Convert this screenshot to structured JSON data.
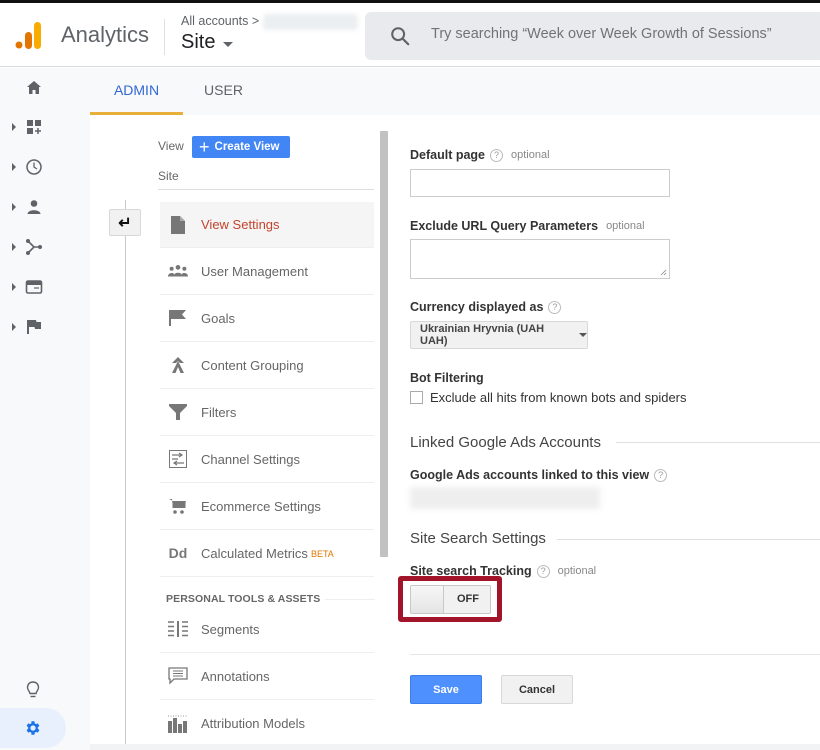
{
  "header": {
    "app_name": "Analytics",
    "breadcrumb": "All accounts >",
    "property_selector": "Site",
    "search_placeholder": "Try searching “Week over Week Growth of Sessions”"
  },
  "rail": {
    "items": [
      {
        "icon": "home-icon"
      },
      {
        "icon": "customization-icon"
      },
      {
        "icon": "realtime-clock-icon"
      },
      {
        "icon": "audience-person-icon"
      },
      {
        "icon": "acquisition-icon"
      },
      {
        "icon": "behavior-icon"
      },
      {
        "icon": "conversions-flag-icon"
      }
    ],
    "bottom": [
      {
        "icon": "lightbulb-icon"
      },
      {
        "icon": "admin-gear-icon"
      }
    ]
  },
  "tabs": [
    {
      "label": "ADMIN",
      "active": true
    },
    {
      "label": "USER",
      "active": false
    }
  ],
  "admin": {
    "view_label": "View",
    "create_view_label": "Create View",
    "view_name": "Site",
    "menu": [
      {
        "label": "View Settings",
        "icon": "document-icon",
        "active": true
      },
      {
        "label": "User Management",
        "icon": "users-icon"
      },
      {
        "label": "Goals",
        "icon": "flag-icon"
      },
      {
        "label": "Content Grouping",
        "icon": "merge-icon"
      },
      {
        "label": "Filters",
        "icon": "filter-icon"
      },
      {
        "label": "Channel Settings",
        "icon": "channel-icon"
      },
      {
        "label": "Ecommerce Settings",
        "icon": "cart-icon"
      },
      {
        "label": "Calculated Metrics",
        "icon": "dd-icon",
        "badge": "BETA"
      }
    ],
    "personal_section_title": "PERSONAL TOOLS & ASSETS",
    "personal_menu": [
      {
        "label": "Segments",
        "icon": "segments-icon"
      },
      {
        "label": "Annotations",
        "icon": "annotation-icon"
      },
      {
        "label": "Attribution Models",
        "icon": "attribution-icon"
      }
    ]
  },
  "form": {
    "default_page": {
      "label": "Default page",
      "optional": "optional",
      "value": ""
    },
    "exclude_params": {
      "label": "Exclude URL Query Parameters",
      "optional": "optional",
      "value": ""
    },
    "currency": {
      "label": "Currency displayed as",
      "selected": "Ukrainian Hryvnia (UAH UAH)"
    },
    "bot_filtering": {
      "label": "Bot Filtering",
      "checkbox_label": "Exclude all hits from known bots and spiders",
      "checked": false
    },
    "linked_ads_section": "Linked Google Ads Accounts",
    "linked_ads_label": "Google Ads accounts linked to this view",
    "site_search_section": "Site Search Settings",
    "site_search": {
      "label": "Site search Tracking",
      "optional": "optional",
      "state": "OFF"
    },
    "save_label": "Save",
    "cancel_label": "Cancel"
  },
  "colors": {
    "accent_blue": "#4285f4",
    "active_tab_underline": "#e8b03a",
    "active_menu_text": "#c5432d",
    "highlight_box": "#a1142a",
    "beta_badge": "#e37400"
  }
}
